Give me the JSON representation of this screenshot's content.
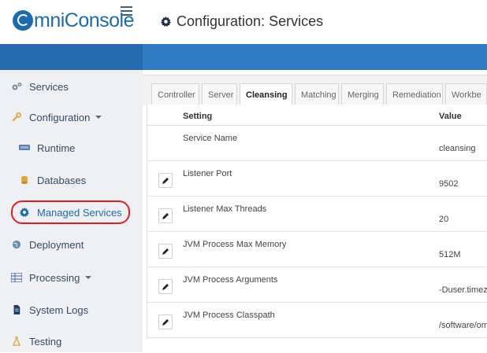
{
  "app": {
    "logo_rest": "mniConsole",
    "page_title": "Configuration: Services"
  },
  "sidebar": {
    "items": [
      {
        "label": "Services",
        "icon": "cogs-icon"
      },
      {
        "label": "Configuration",
        "icon": "wrench-icon",
        "has_caret": true
      },
      {
        "label": "Runtime",
        "icon": "monitor-icon"
      },
      {
        "label": "Databases",
        "icon": "database-icon"
      },
      {
        "label": "Managed Services",
        "icon": "gear-icon",
        "selected": true
      },
      {
        "label": "Deployment",
        "icon": "globe-icon"
      },
      {
        "label": "Processing",
        "icon": "grid-icon",
        "has_caret": true
      },
      {
        "label": "System Logs",
        "icon": "file-icon"
      },
      {
        "label": "Testing",
        "icon": "flask-icon"
      }
    ]
  },
  "tabs": [
    {
      "label": "Controller"
    },
    {
      "label": "Server"
    },
    {
      "label": "Cleansing",
      "active": true
    },
    {
      "label": "Matching"
    },
    {
      "label": "Merging"
    },
    {
      "label": "Remediation"
    },
    {
      "label": "Workbe"
    }
  ],
  "table": {
    "headers": {
      "setting": "Setting",
      "value": "Value"
    },
    "rows": [
      {
        "setting": "Service Name",
        "value": "cleansing",
        "editable": false
      },
      {
        "setting": "Listener Port",
        "value": "9502",
        "editable": true
      },
      {
        "setting": "Listener Max Threads",
        "value": "20",
        "editable": true
      },
      {
        "setting": "JVM Process Max Memory",
        "value": "512M",
        "editable": true
      },
      {
        "setting": "JVM Process Arguments",
        "value": "-Duser.timez",
        "editable": true
      },
      {
        "setting": "JVM Process Classpath",
        "value": "/software/om",
        "editable": true
      }
    ]
  },
  "colors": {
    "brand": "#1c6bb0",
    "bar": "#2f7bc4",
    "highlight": "#e02020"
  }
}
